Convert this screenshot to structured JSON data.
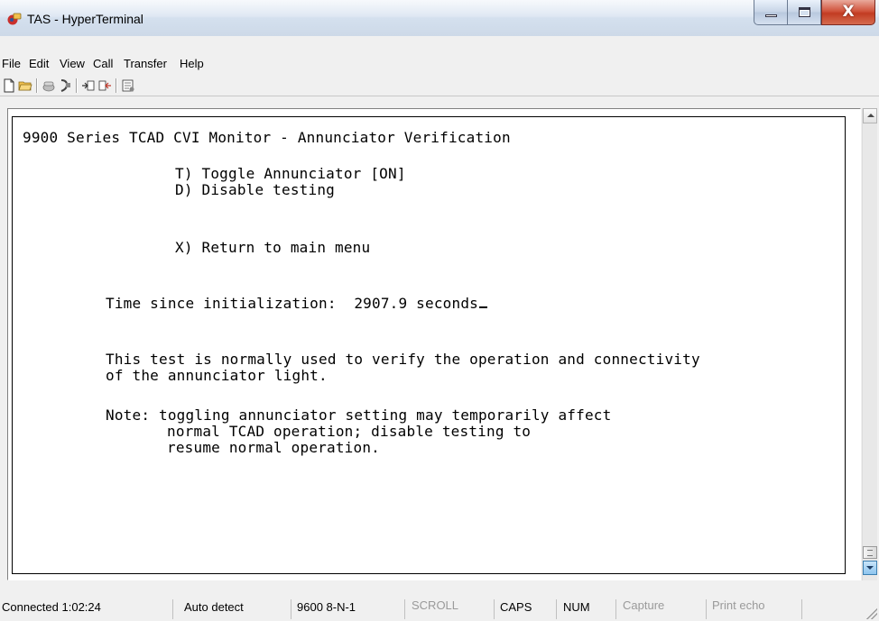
{
  "window": {
    "title": "TAS - HyperTerminal",
    "icon": "hyperterminal-phone-icon"
  },
  "menu": {
    "items": [
      {
        "label": "File"
      },
      {
        "label": "Edit"
      },
      {
        "label": "View"
      },
      {
        "label": "Call"
      },
      {
        "label": "Transfer"
      },
      {
        "label": "Help"
      }
    ]
  },
  "toolbar": {
    "buttons": [
      "new-document-icon",
      "open-folder-icon",
      "disconnect-icon",
      "connect-icon",
      "send-file-icon",
      "receive-file-icon",
      "properties-icon"
    ]
  },
  "terminal": {
    "header": "9900 Series TCAD CVI Monitor - Annunciator Verification",
    "option_t": "T) Toggle Annunciator [ON]",
    "option_d": "D) Disable testing",
    "option_x": "X) Return to main menu",
    "time_label": "Time since initialization:",
    "time_value": "2907.9 seconds",
    "desc_line1": "This test is normally used to verify the operation and connectivity",
    "desc_line2": "of the annunciator light.",
    "note_line1": "Note: toggling annunciator setting may temporarily affect",
    "note_line2": "normal TCAD operation; disable testing to",
    "note_line3": "resume normal operation."
  },
  "status": {
    "connected": "Connected 1:02:24",
    "detect": "Auto detect",
    "settings": "9600 8-N-1",
    "scroll": "SCROLL",
    "caps": "CAPS",
    "num": "NUM",
    "capture": "Capture",
    "print_echo": "Print echo"
  }
}
